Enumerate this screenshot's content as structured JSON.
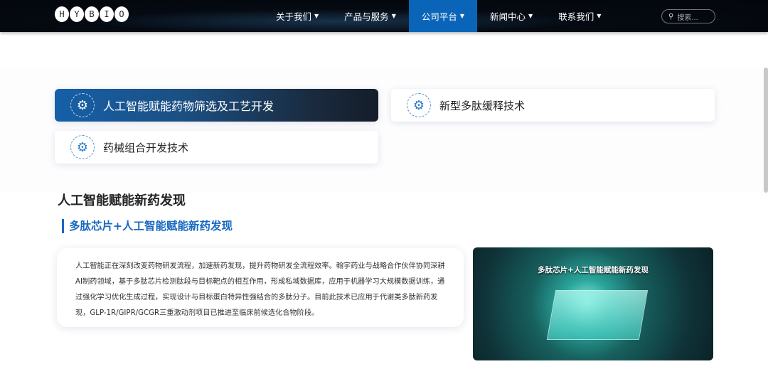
{
  "nav": {
    "logo": "HYBIO",
    "items": [
      {
        "label": "关于我们"
      },
      {
        "label": "产品与服务"
      },
      {
        "label": "公司平台",
        "active": true
      },
      {
        "label": "新闻中心"
      },
      {
        "label": "联系我们"
      }
    ],
    "search_placeholder": "搜索..."
  },
  "tabs": [
    {
      "label": "人工智能赋能药物筛选及工艺开发",
      "active": true
    },
    {
      "label": "新型多肽缓释技术"
    },
    {
      "label": "药械组合开发技术"
    }
  ],
  "section": {
    "title": "人工智能赋能新药发现",
    "subtitle": "多肽芯片+人工智能赋能新药发现",
    "body": "人工智能正在深刻改变药物研发流程，加速新药发现，提升药物研发全流程效率。翰宇药业与战略合作伙伴协同深耕AI制药领域，基于多肽芯片检测肽段与目标靶点的相互作用，形成私域数据库，应用于机器学习大规模数据训练，通过强化学习优化生成过程，实现设计与目标蛋白特异性强结合的多肽分子。目前此技术已应用于代谢类多肽新药发现，GLP-1R/GIPR/GCGR三重激动剂项目已推进至临床前候选化合物阶段。",
    "image_caption": "多肽芯片+人工智能赋能新药发现"
  },
  "colors": {
    "accent": "#0a64b8",
    "subtitle": "#1668c0"
  }
}
